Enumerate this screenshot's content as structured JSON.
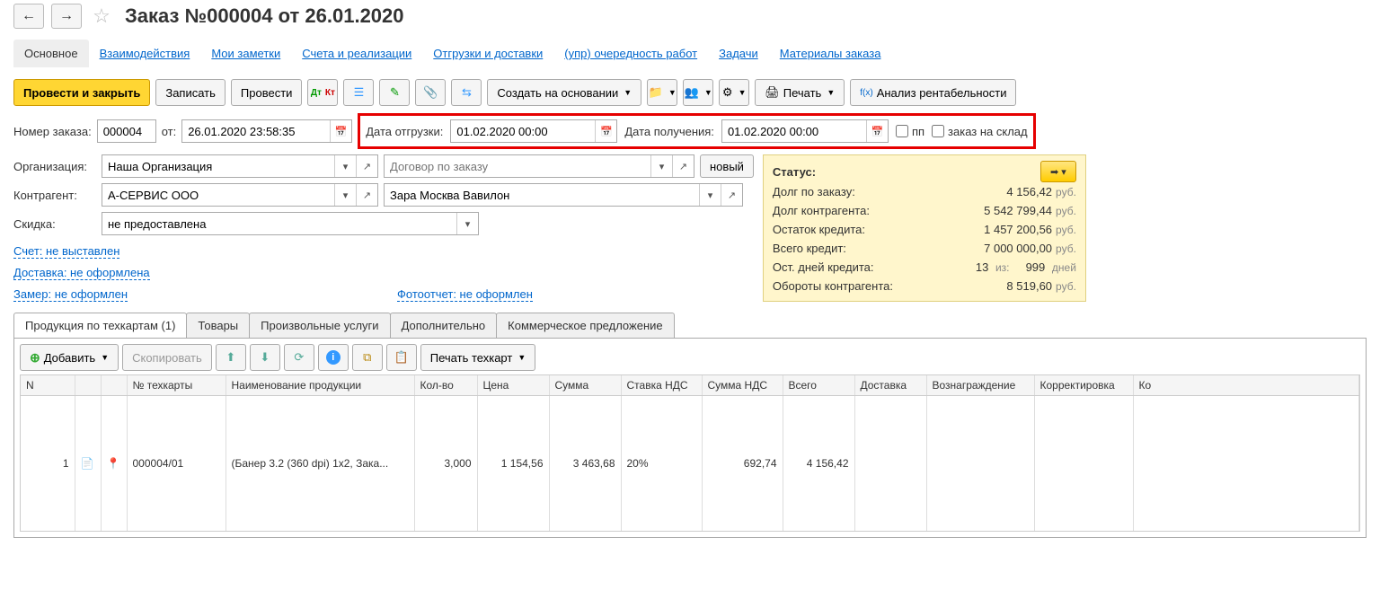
{
  "header": {
    "title": "Заказ №000004 от 26.01.2020"
  },
  "nav": {
    "tabs": [
      "Основное",
      "Взаимодействия",
      "Мои заметки",
      "Счета и реализации",
      "Отгрузки и доставки",
      "(упр) очередность работ",
      "Задачи",
      "Материалы заказа"
    ]
  },
  "toolbar": {
    "post_close": "Провести и закрыть",
    "save": "Записать",
    "post": "Провести",
    "create_based": "Создать на основании",
    "print": "Печать",
    "profitability": "Анализ рентабельности"
  },
  "form": {
    "order_no_label": "Номер заказа:",
    "order_no": "000004",
    "from_label": "от:",
    "datetime": "26.01.2020 23:58:35",
    "ship_date_label": "Дата отгрузки:",
    "ship_date": "01.02.2020 00:00",
    "recv_date_label": "Дата получения:",
    "recv_date": "01.02.2020 00:00",
    "pp_label": "пп",
    "to_stock_label": "заказ на склад",
    "org_label": "Организация:",
    "org": "Наша Организация",
    "contract_placeholder": "Договор по заказу",
    "new_btn": "новый",
    "counterparty_label": "Контрагент:",
    "counterparty": "А-СЕРВИС ООО",
    "delivery_point": "Зара Москва Вавилон",
    "discount_label": "Скидка:",
    "discount": "не предоставлена"
  },
  "links": {
    "invoice": "Счет: не выставлен",
    "delivery": "Доставка: не оформлена",
    "measure": "Замер: не оформлен",
    "photo": "Фотоотчет: не оформлен"
  },
  "status": {
    "title": "Статус:",
    "rows": [
      {
        "label": "Долг по заказу:",
        "value": "4 156,42",
        "unit": "руб."
      },
      {
        "label": "Долг контрагента:",
        "value": "5 542 799,44",
        "unit": "руб."
      },
      {
        "label": "Остаток кредита:",
        "value": "1 457 200,56",
        "unit": "руб."
      },
      {
        "label": "Всего кредит:",
        "value": "7 000 000,00",
        "unit": "руб."
      }
    ],
    "credit_days_label": "Ост. дней кредита:",
    "credit_days_val": "13",
    "credit_days_of": "из:",
    "credit_days_total": "999",
    "credit_days_unit": "дней",
    "turnover_label": "Обороты контрагента:",
    "turnover_val": "8 519,60",
    "turnover_unit": "руб."
  },
  "bottom_tabs": [
    "Продукция по техкартам (1)",
    "Товары",
    "Произвольные услуги",
    "Дополнительно",
    "Коммерческое предложение"
  ],
  "sub_toolbar": {
    "add": "Добавить",
    "copy": "Скопировать",
    "print_tech": "Печать техкарт"
  },
  "table": {
    "cols": [
      "N",
      "",
      "",
      "№ техкарты",
      "Наименование продукции",
      "Кол-во",
      "Цена",
      "Сумма",
      "Ставка НДС",
      "Сумма НДС",
      "Всего",
      "Доставка",
      "Вознаграждение",
      "Корректировка",
      "Ко"
    ],
    "row": {
      "n": "1",
      "techcard": "000004/01",
      "name": "(Банер 3.2 (360 dpi)  1x2, Зака...",
      "qty": "3,000",
      "price": "1 154,56",
      "sum": "3 463,68",
      "vat_rate": "20%",
      "vat_sum": "692,74",
      "total": "4 156,42"
    }
  }
}
